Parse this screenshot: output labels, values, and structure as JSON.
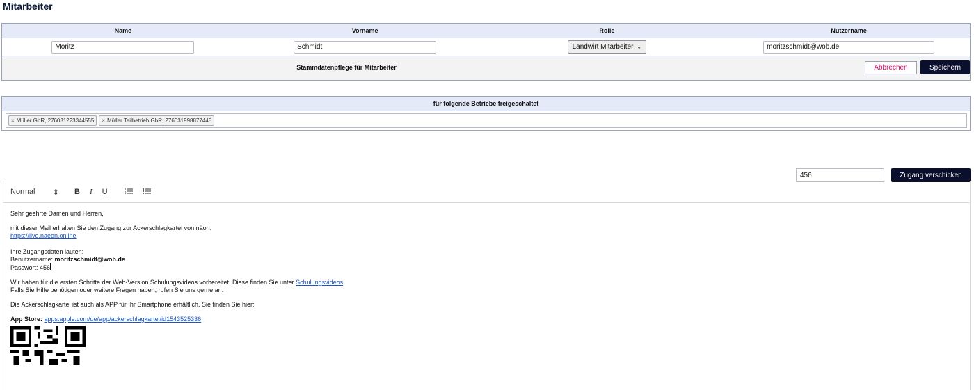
{
  "page": {
    "title": "Mitarbeiter"
  },
  "employee_table": {
    "columns": [
      "Name",
      "Vorname",
      "Rolle",
      "Nutzername"
    ],
    "row": {
      "name": "Moritz",
      "vorname": "Schmidt",
      "rolle": "Landwirt Mitarbeiter",
      "nutzername": "moritzschmidt@wob.de"
    },
    "footer_label": "Stammdatenpflege für Mitarbeiter",
    "cancel_label": "Abbrechen",
    "save_label": "Speichern"
  },
  "betriebe": {
    "header": "für folgende Betriebe freigeschaltet",
    "tags": [
      {
        "label": "Müller GbR, 276031223344555"
      },
      {
        "label": "Müller Teilbetrieb GbR, 276031998877445"
      }
    ]
  },
  "access": {
    "password_value": "456",
    "send_label": "Zugang verschicken"
  },
  "editor": {
    "toolbar": {
      "format": "Normal",
      "bold": "B",
      "italic": "I",
      "underline": "U"
    },
    "content": {
      "greeting": "Sehr geehrte Damen und Herren,",
      "intro": "mit dieser Mail erhalten Sie den Zugang zur Ackerschlagkartei von näon:",
      "link": "https://live.naeon.online",
      "credentials_intro": "Ihre Zugangsdaten lauten:",
      "username_label": "Benutzername: ",
      "username_value": "moritzschmidt@wob.de",
      "password_label": "Passwort: ",
      "password_value": "456",
      "videos_text": "Wir haben für die ersten Schritte der Web-Version Schulungsvideos vorbereitet. Diese finden Sie unter ",
      "videos_link": "Schulungsvideos",
      "videos_end": ".",
      "help_text": "Falls Sie Hilfe benötigen oder weitere Fragen haben, rufen Sie uns gerne an.",
      "app_text": "Die Ackerschlagkartei ist auch als APP für Ihr Smartphone erhältlich. Sie finden Sie hier:",
      "appstore_label": "App Store:",
      "appstore_link": "apps.apple.com/de/app/ackerschlagkartei/id1543525336"
    }
  },
  "icons": {
    "format_chevron": "up-down-chevron-icon",
    "ordered_list": "ordered-list-icon",
    "bullet_list": "bullet-list-icon",
    "remove_tag": "close-icon",
    "select_chevron": "chevron-down-icon"
  },
  "colors": {
    "header_bg": "#e4eaf7",
    "primary_button": "#0b0f2e",
    "cancel_text": "#d0106e",
    "link": "#1a56c9"
  }
}
